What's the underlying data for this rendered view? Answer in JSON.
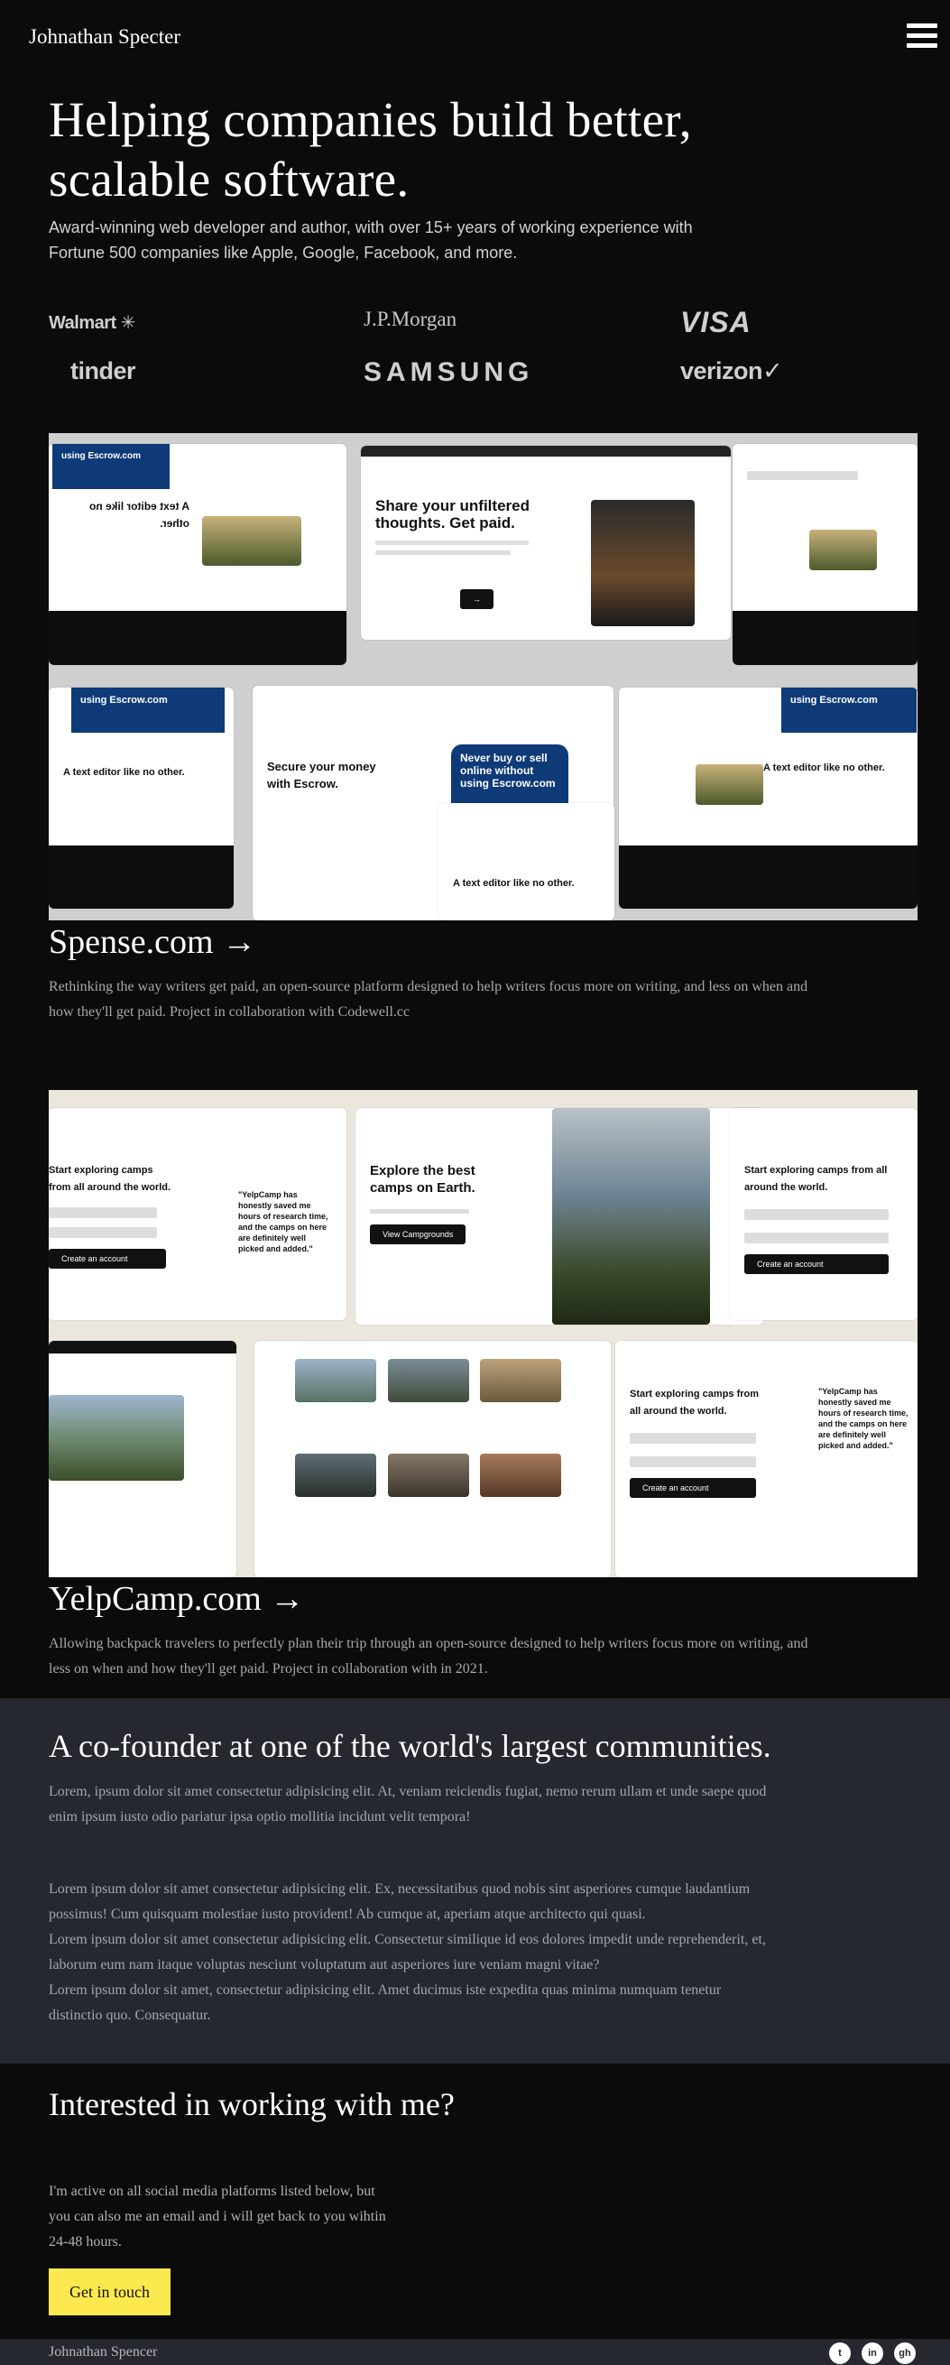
{
  "nav": {
    "brand": "Johnathan Specter",
    "menu_icon": "hamburger-menu-icon"
  },
  "hero": {
    "title_line1": "Helping companies build better,",
    "title_line2": "scalable software.",
    "subtitle_line1": "Award-winning web developer and author, with over 15+ years of working experience with",
    "subtitle_line2": "Fortune 500 companies like Apple, Google, Facebook, and more."
  },
  "clients": {
    "walmart": "Walmart",
    "jpmorgan": "J.P.Morgan",
    "visa": "VISA",
    "tinder": "tinder",
    "samsung": "SAMSUNG",
    "verizon": "verizon"
  },
  "projects": [
    {
      "title": "Spense.com →",
      "description_line1": "Rethinking the way writers get paid, an open-source platform designed to help writers focus more on writing, and less on when and",
      "description_line2": "how they'll get paid. Project in collaboration with Codewell.cc",
      "mockup": {
        "headline": "Share your unfiltered thoughts. Get paid.",
        "secure_headline": "Secure your money with Escrow.",
        "blue_card": "Never buy or sell online without using Escrow.com",
        "editor_headline": "A text editor like no other.",
        "escrow_tag": "using Escrow.com"
      }
    },
    {
      "title": "YelpCamp.com →",
      "description_line1": "Allowing backpack travelers to perfectly plan their trip through an open-source designed to help writers focus more on writing, and",
      "description_line2": "less on when and how they'll get paid. Project in collaboration with in 2021.",
      "mockup": {
        "headline": "Explore the best camps on Earth.",
        "signup_headline": "Start exploring camps from all around the world.",
        "quote": "\"YelpCamp has honestly saved me hours of research time, and the camps on here are definitely well picked and added.\"",
        "create_btn": "Create an account",
        "view_btn": "View Campgrounds"
      }
    }
  ],
  "about": {
    "title": "A co-founder at one of the world's largest communities.",
    "lead_line1": "Lorem, ipsum dolor sit amet consectetur adipisicing elit. At, veniam reiciendis fugiat, nemo rerum ullam et unde saepe quod",
    "lead_line2": "enim ipsum iusto odio pariatur ipsa optio mollitia incidunt velit tempora!",
    "body_line1": "Lorem ipsum dolor sit amet consectetur adipisicing elit. Ex, necessitatibus quod nobis sint asperiores cumque laudantium",
    "body_line2": "possimus! Cum quisquam molestiae iusto provident! Ab cumque at, aperiam atque architecto qui quasi.",
    "body_line3": "Lorem ipsum dolor sit amet consectetur adipisicing elit. Consectetur similique id eos dolores impedit unde reprehenderit, et,",
    "body_line4": "laborum eum nam itaque voluptas nesciunt voluptatum aut asperiores iure veniam magni vitae?",
    "body_line5": "Lorem ipsum dolor sit amet, consectetur adipisicing elit. Amet ducimus iste expedita quas minima numquam tenetur",
    "body_line6": "distinctio quo. Consequatur."
  },
  "contact": {
    "title": "Interested in working with me?",
    "text_line1": "I'm active on all social media platforms listed below, but",
    "text_line2": "you can also me an email and i will get back to you wihtin",
    "text_line3": "24-48 hours.",
    "cta": "Get in touch"
  },
  "footer": {
    "name": "Johnathan Spencer",
    "socials": [
      {
        "icon": "twitter-icon",
        "glyph": "t"
      },
      {
        "icon": "linkedin-icon",
        "glyph": "in"
      },
      {
        "icon": "github-icon",
        "glyph": "gh"
      }
    ]
  },
  "colors": {
    "background": "#0b0b0b",
    "section_alt": "#262830",
    "accent_button": "#fce94f",
    "muted_text": "#a4a6ae"
  }
}
